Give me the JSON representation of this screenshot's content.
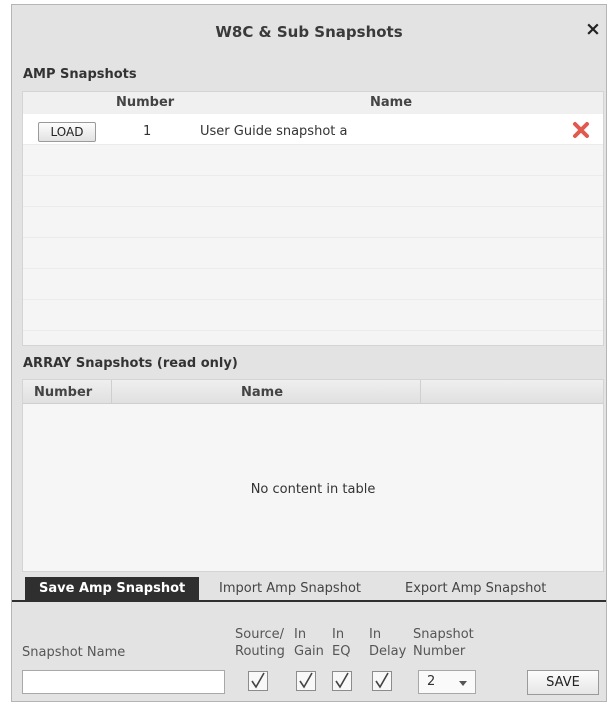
{
  "window": {
    "title": "W8C & Sub Snapshots",
    "close_symbol": "×"
  },
  "amp_snapshots": {
    "section_title": "AMP Snapshots",
    "columns": {
      "number": "Number",
      "name": "Name"
    },
    "rows": [
      {
        "load_label": "LOAD",
        "number": "1",
        "name": "User Guide snapshot a",
        "delete_icon": "red-x-icon"
      }
    ]
  },
  "array_snapshots": {
    "section_title": "ARRAY Snapshots (read only)",
    "columns": {
      "number": "Number",
      "name": "Name"
    },
    "empty_message": "No content in table"
  },
  "tabs": [
    {
      "label": "Save Amp Snapshot",
      "active": true
    },
    {
      "label": "Import Amp Snapshot",
      "active": false
    },
    {
      "label": "Export Amp Snapshot",
      "active": false
    }
  ],
  "form": {
    "snapshot_name_label": "Snapshot Name",
    "snapshot_name_value": "",
    "checkboxes": [
      {
        "label_line1": "Source/",
        "label_line2": "Routing",
        "checked": true
      },
      {
        "label_line1": "In",
        "label_line2": "Gain",
        "checked": true
      },
      {
        "label_line1": "In",
        "label_line2": "EQ",
        "checked": true
      },
      {
        "label_line1": "In",
        "label_line2": "Delay",
        "checked": true
      }
    ],
    "snapshot_number_label_line1": "Snapshot",
    "snapshot_number_label_line2": "Number",
    "snapshot_number_value": "2",
    "save_label": "SAVE"
  },
  "colors": {
    "delete_icon": "#e05a4e",
    "active_tab": "#2f2f2f",
    "dialog_bg": "#e3e3e3"
  }
}
